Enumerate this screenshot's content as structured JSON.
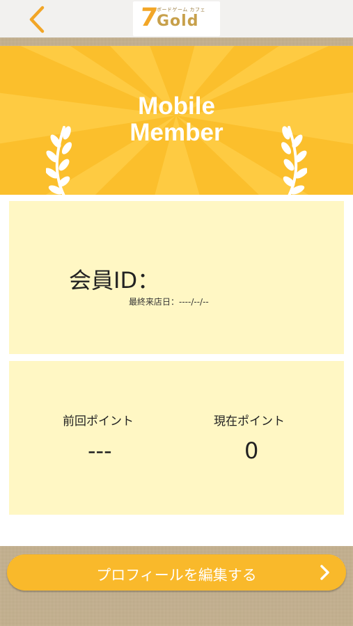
{
  "header": {
    "logo_text": "Gold",
    "logo_number": "7",
    "logo_subtitle": "ボードゲーム カフェ"
  },
  "banner": {
    "title_line1": "Mobile",
    "title_line2": "Member"
  },
  "member": {
    "id_label": "会員ID：",
    "last_visit_label": "最終来店日：----/--/--"
  },
  "points": {
    "previous_label": "前回ポイント",
    "previous_value": "---",
    "current_label": "現在ポイント",
    "current_value": "0"
  },
  "actions": {
    "edit_profile_label": "プロフィールを編集する"
  },
  "colors": {
    "accent": "#fbbf2c",
    "card": "#fff7c4",
    "button": "#f9b92b",
    "back_chevron": "#f2a627"
  },
  "icons": {
    "back": "chevron-left-icon",
    "laurel": "laurel-branch-icon",
    "next": "chevron-right-icon"
  }
}
